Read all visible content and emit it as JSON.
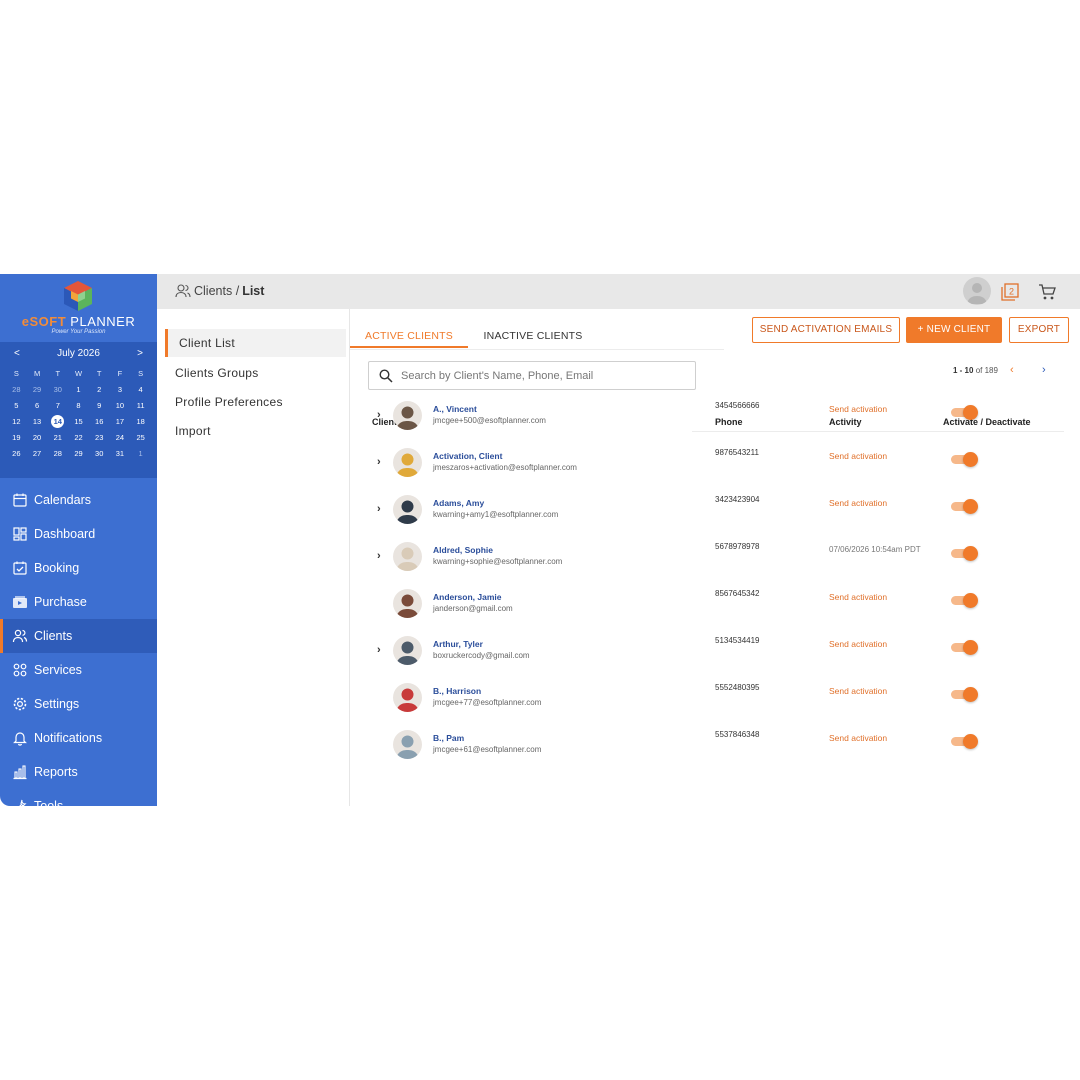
{
  "brand": {
    "name_e": "eSOFT",
    "name_rest": " PLANNER",
    "tagline": "Power Your Passion"
  },
  "calendar": {
    "month_label": "July 2026",
    "prev": "<",
    "next": ">",
    "dow": [
      "S",
      "M",
      "T",
      "W",
      "T",
      "F",
      "S"
    ],
    "weeks": [
      [
        "28",
        "29",
        "30",
        "1",
        "2",
        "3",
        "4"
      ],
      [
        "5",
        "6",
        "7",
        "8",
        "9",
        "10",
        "11"
      ],
      [
        "12",
        "13",
        "14",
        "15",
        "16",
        "17",
        "18"
      ],
      [
        "19",
        "20",
        "21",
        "22",
        "23",
        "24",
        "25"
      ],
      [
        "26",
        "27",
        "28",
        "29",
        "30",
        "31",
        "1"
      ]
    ],
    "today": "14"
  },
  "nav": {
    "items": [
      {
        "label": "Calendars",
        "icon": "calendar-icon"
      },
      {
        "label": "Dashboard",
        "icon": "dashboard-icon"
      },
      {
        "label": "Booking",
        "icon": "booking-icon"
      },
      {
        "label": "Purchase",
        "icon": "purchase-icon"
      },
      {
        "label": "Clients",
        "icon": "clients-icon"
      },
      {
        "label": "Services",
        "icon": "services-icon"
      },
      {
        "label": "Settings",
        "icon": "settings-icon"
      },
      {
        "label": "Notifications",
        "icon": "bell-icon"
      },
      {
        "label": "Reports",
        "icon": "reports-icon"
      },
      {
        "label": "Tools",
        "icon": "tools-icon"
      }
    ],
    "active": "Clients"
  },
  "breadcrumb": {
    "section": "Clients",
    "separator": "/",
    "page": "List"
  },
  "notifications_count": "2",
  "subnav": {
    "items": [
      "Client List",
      "Clients Groups",
      "Profile Preferences",
      "Import"
    ],
    "active": "Client List"
  },
  "tabs": {
    "active": "ACTIVE CLIENTS",
    "inactive": "INACTIVE CLIENTS"
  },
  "actions": {
    "send_activation": "SEND ACTIVATION EMAILS",
    "new_client": "+ NEW CLIENT",
    "export": "EXPORT"
  },
  "search": {
    "placeholder": "Search by Client's Name, Phone, Email"
  },
  "pagination": {
    "range": "1 - 10",
    "of": "of 189",
    "prev": "‹",
    "next": "›"
  },
  "table": {
    "headers": {
      "client": "Client",
      "phone": "Phone",
      "activity": "Activity",
      "toggle": "Activate / Deactivate"
    },
    "rows": [
      {
        "name": "A., Vincent",
        "email": "jmcgee+500@esoftplanner.com",
        "phone": "3454566666",
        "activity": "Send activation",
        "activity_type": "link",
        "expandable": true,
        "active": true,
        "avatar_color": "#6b5646"
      },
      {
        "name": "Activation, Client",
        "email": "jmeszaros+activation@esoftplanner.com",
        "phone": "9876543211",
        "activity": "Send activation",
        "activity_type": "link",
        "expandable": true,
        "active": true,
        "avatar_color": "#e0a93a"
      },
      {
        "name": "Adams, Amy",
        "email": "kwarning+amy1@esoftplanner.com",
        "phone": "3423423904",
        "activity": "Send activation",
        "activity_type": "link",
        "expandable": true,
        "active": true,
        "avatar_color": "#2f3b4a"
      },
      {
        "name": "Aldred, Sophie",
        "email": "kwarning+sophie@esoftplanner.com",
        "phone": "5678978978",
        "activity": "07/06/2026 10:54am PDT",
        "activity_type": "date",
        "expandable": true,
        "active": true,
        "avatar_color": "#d9cbb8"
      },
      {
        "name": "Anderson, Jamie",
        "email": "janderson@gmail.com",
        "phone": "8567645342",
        "activity": "Send activation",
        "activity_type": "link",
        "expandable": false,
        "active": true,
        "avatar_color": "#7a4b3a"
      },
      {
        "name": "Arthur, Tyler",
        "email": "boxruckercody@gmail.com",
        "phone": "5134534419",
        "activity": "Send activation",
        "activity_type": "link",
        "expandable": true,
        "active": true,
        "avatar_color": "#4d5b6a"
      },
      {
        "name": "B., Harrison",
        "email": "jmcgee+77@esoftplanner.com",
        "phone": "5552480395",
        "activity": "Send activation",
        "activity_type": "link",
        "expandable": false,
        "active": true,
        "avatar_color": "#c83a3a"
      },
      {
        "name": "B., Pam",
        "email": "jmcgee+61@esoftplanner.com",
        "phone": "5537846348",
        "activity": "Send activation",
        "activity_type": "link",
        "expandable": false,
        "active": true,
        "avatar_color": "#8aa0b0"
      }
    ]
  }
}
